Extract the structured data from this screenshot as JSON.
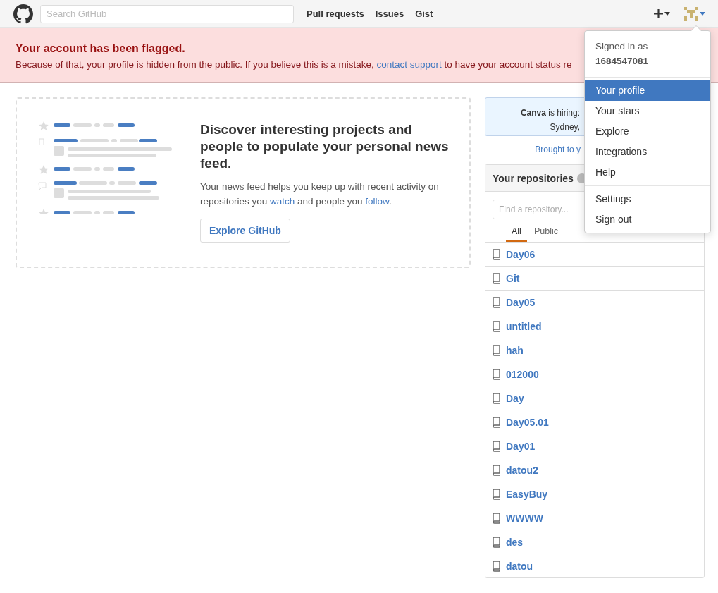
{
  "header": {
    "search_placeholder": "Search GitHub",
    "nav": [
      "Pull requests",
      "Issues",
      "Gist"
    ]
  },
  "flash": {
    "title": "Your account has been flagged.",
    "message": "Because of that, your profile is hidden from the public. If you believe this is a mistake, ",
    "link": "contact support",
    "message_end": " to have your account status re"
  },
  "news": {
    "title": "Discover interesting projects and people to populate your personal news feed.",
    "text_start": "Your news feed helps you keep up with recent activity on repositories you ",
    "watch_link": "watch",
    "text_middle": " and people you ",
    "follow_link": "follow",
    "text_end": ".",
    "button": "Explore GitHub"
  },
  "sidebar": {
    "ad_lines": [
      "**Canva** is hiring:",
      "Sydney,"
    ],
    "brought": "Brought to y",
    "repos_title": "Your repositories",
    "find_placeholder": "Find a repository...",
    "filters": [
      {
        "label": "All",
        "selected": true
      },
      {
        "label": "Public",
        "selected": false
      }
    ],
    "repos": [
      "Day06",
      "Git",
      "Day05",
      "untitled",
      "hah",
      "012000",
      "Day",
      "Day05.01",
      "Day01",
      "datou2",
      "EasyBuy",
      "WWWW",
      "des",
      "datou"
    ]
  },
  "menu": {
    "signed_in_label": "Signed in as",
    "username": "1684547081",
    "groups": [
      [
        {
          "label": "Your profile",
          "selected": true
        },
        {
          "label": "Your stars",
          "selected": false
        },
        {
          "label": "Explore",
          "selected": false
        },
        {
          "label": "Integrations",
          "selected": false
        },
        {
          "label": "Help",
          "selected": false
        }
      ],
      [
        {
          "label": "Settings",
          "selected": false
        },
        {
          "label": "Sign out",
          "selected": false
        }
      ]
    ]
  }
}
